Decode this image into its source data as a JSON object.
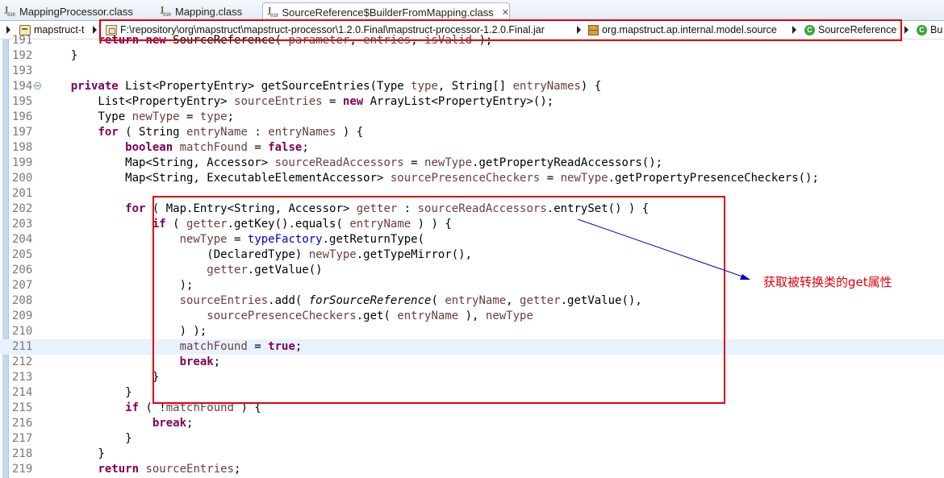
{
  "tabs": [
    {
      "label": "MappingProcessor.class"
    },
    {
      "label": "Mapping.class"
    },
    {
      "label": "SourceReference$BuilderFromMapping.class",
      "close": "✕"
    }
  ],
  "breadcrumb": {
    "project": "mapstruct-t",
    "jar": "F:\\repository\\org\\mapstruct\\mapstruct-processor\\1.2.0.Final\\mapstruct-processor-1.2.0.Final.jar",
    "package": "org.mapstruct.ap.internal.model.source",
    "class": "SourceReference",
    "inner": "Bu",
    "class_icon_letter": "C"
  },
  "editor": {
    "line_numbers": [
      "191",
      "192",
      "193",
      "194",
      "195",
      "196",
      "197",
      "198",
      "199",
      "200",
      "201",
      "202",
      "203",
      "204",
      "205",
      "206",
      "207",
      "208",
      "209",
      "210",
      "211",
      "212",
      "213",
      "214",
      "215",
      "216",
      "217",
      "218",
      "219"
    ],
    "current_line": "211"
  },
  "annotation": {
    "text": "获取被转换类的get属性",
    "color": "#e0000a",
    "arrow_color": "#0000cc"
  },
  "colors": {
    "keyword": "#7f0055",
    "local_variable": "#6a3e3e",
    "field": "#0000c0"
  }
}
